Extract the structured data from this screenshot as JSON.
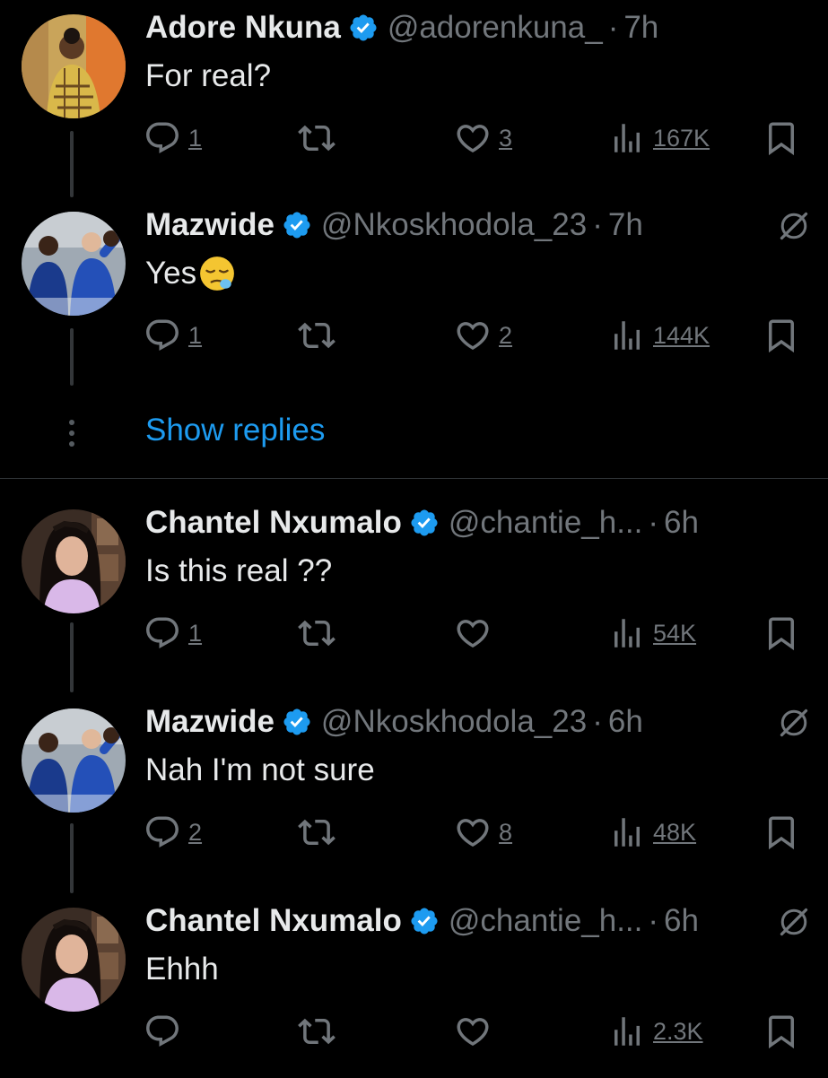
{
  "colors": {
    "background": "#000000",
    "text": "#e7e9ea",
    "muted": "#71767b",
    "link": "#1d9bf0",
    "verified": "#1d9bf0"
  },
  "tweets": [
    {
      "name": "Adore Nkuna",
      "handle": "@adorenkuna_",
      "separator": "·",
      "time": "7h",
      "text": "For real?",
      "emoji": "",
      "replies": "1",
      "retweets": "",
      "likes": "3",
      "views": "167K",
      "avatar": "avatar-adore",
      "grok_icon": false
    },
    {
      "name": "Mazwide",
      "handle": "@Nkoskhodola_23",
      "separator": "·",
      "time": "7h",
      "text": "Yes",
      "emoji": "😪",
      "replies": "1",
      "retweets": "",
      "likes": "2",
      "views": "144K",
      "avatar": "avatar-mazwide",
      "grok_icon": true
    },
    {
      "name": "Chantel Nxumalo",
      "handle": "@chantie_h...",
      "separator": "·",
      "time": "6h",
      "text": "Is this real ??",
      "emoji": "",
      "replies": "1",
      "retweets": "",
      "likes": "",
      "views": "54K",
      "avatar": "avatar-chantel",
      "grok_icon": false
    },
    {
      "name": "Mazwide",
      "handle": "@Nkoskhodola_23",
      "separator": "·",
      "time": "6h",
      "text": "Nah I'm not sure",
      "emoji": "",
      "replies": "2",
      "retweets": "",
      "likes": "8",
      "views": "48K",
      "avatar": "avatar-mazwide",
      "grok_icon": true
    },
    {
      "name": "Chantel Nxumalo",
      "handle": "@chantie_h...",
      "separator": "·",
      "time": "6h",
      "text": "Ehhh",
      "emoji": "",
      "replies": "",
      "retweets": "",
      "likes": "",
      "views": "2.3K",
      "avatar": "avatar-chantel",
      "grok_icon": true
    }
  ],
  "show_replies": "Show replies",
  "icons": {
    "reply": "reply-icon",
    "retweet": "retweet-icon",
    "like": "heart-icon",
    "views": "views-icon",
    "bookmark": "bookmark-icon",
    "grok": "grok-icon",
    "verified": "verified-badge-icon",
    "more": "more-dots-icon"
  }
}
